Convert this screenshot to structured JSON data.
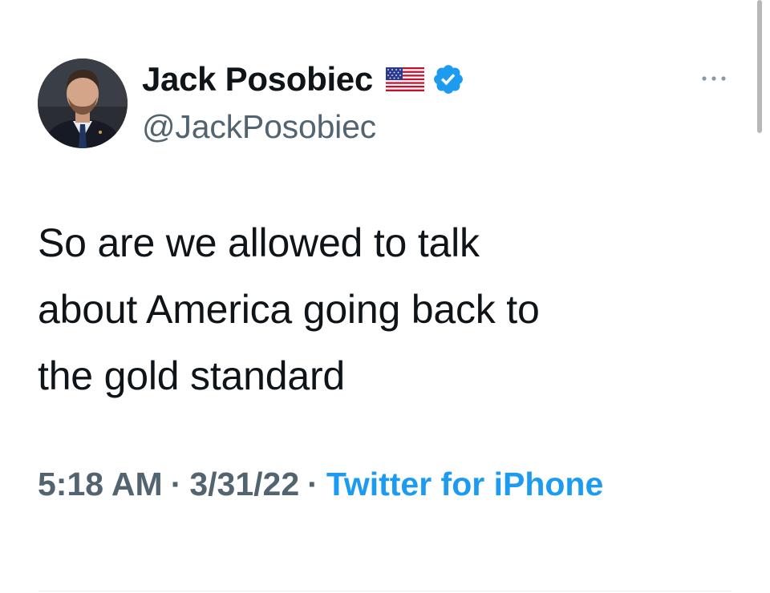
{
  "tweet": {
    "author": {
      "display_name": "Jack Posobiec",
      "handle": "@JackPosobiec",
      "flag_icon": "us-flag-icon",
      "verified_icon": "verified-badge-icon",
      "verified_color": "#1d9bf0"
    },
    "more_icon": "more-options-icon",
    "text_lines": [
      "So are we allowed to talk",
      "about America going back to",
      "the gold standard"
    ],
    "time": "5:18 AM",
    "date": "3/31/22",
    "separator": "·",
    "source": "Twitter for iPhone",
    "source_color": "#1d9bf0"
  }
}
